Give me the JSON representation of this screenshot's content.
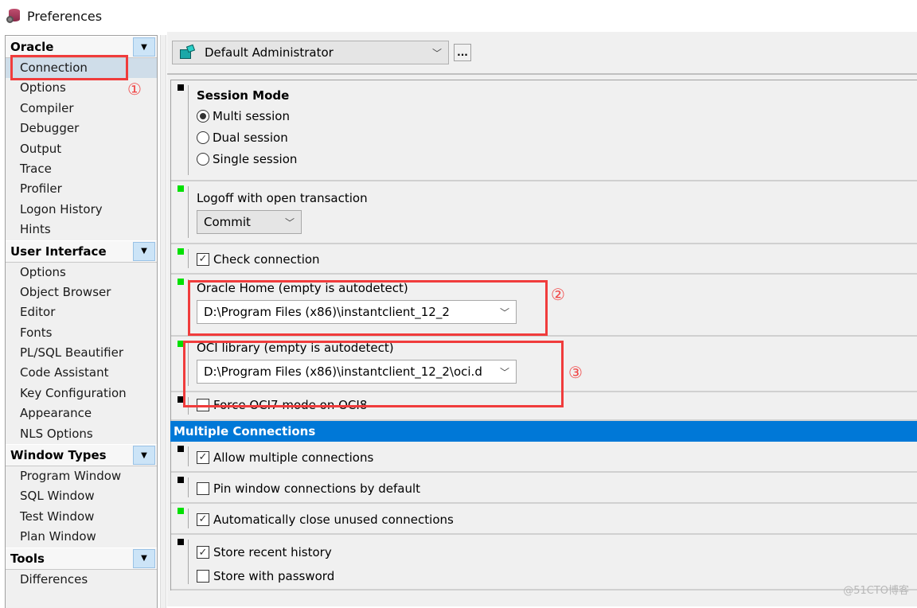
{
  "window": {
    "title": "Preferences",
    "icon": "database-gear-icon"
  },
  "sidebar": {
    "groups": [
      {
        "label": "Oracle",
        "toggle_icon": "dropdown-arrow-icon",
        "items": [
          "Connection",
          "Options",
          "Compiler",
          "Debugger",
          "Output",
          "Trace",
          "Profiler",
          "Logon History",
          "Hints"
        ],
        "selected": "Connection"
      },
      {
        "label": "User Interface",
        "toggle_icon": "dropdown-arrow-icon",
        "items": [
          "Options",
          "Object Browser",
          "Editor",
          "Fonts",
          "PL/SQL Beautifier",
          "Code Assistant",
          "Key Configuration",
          "Appearance",
          "NLS Options"
        ]
      },
      {
        "label": "Window Types",
        "toggle_icon": "dropdown-arrow-icon",
        "items": [
          "Program Window",
          "SQL Window",
          "Test Window",
          "Plan Window"
        ]
      },
      {
        "label": "Tools",
        "toggle_icon": "dropdown-arrow-icon",
        "items": [
          "Differences"
        ]
      }
    ]
  },
  "toolbar": {
    "profile": "Default Administrator",
    "profile_icon": "admin-blocks-icon",
    "more_button": "..."
  },
  "settings": {
    "session_mode": {
      "title": "Session Mode",
      "options": [
        "Multi session",
        "Dual session",
        "Single session"
      ],
      "selected": "Multi session",
      "marker": "black"
    },
    "logoff": {
      "label": "Logoff with open transaction",
      "value": "Commit",
      "marker": "green"
    },
    "check_connection": {
      "label": "Check connection",
      "checked": true,
      "marker": "green"
    },
    "oracle_home": {
      "label": "Oracle Home (empty is autodetect)",
      "value": "D:\\Program Files (x86)\\instantclient_12_2",
      "marker": "green"
    },
    "oci_library": {
      "label": "OCI library (empty is autodetect)",
      "value": "D:\\Program Files (x86)\\instantclient_12_2\\oci.d",
      "marker": "green"
    },
    "force_oci7": {
      "label": "Force OCI7 mode on OCI8",
      "checked": false,
      "marker": "black"
    }
  },
  "multiple_connections": {
    "title": "Multiple Connections",
    "allow_multiple": {
      "label": "Allow multiple connections",
      "checked": true,
      "marker": "black"
    },
    "pin_window": {
      "label": "Pin window connections by default",
      "checked": false,
      "marker": "black"
    },
    "auto_close": {
      "label": "Automatically close unused connections",
      "checked": true,
      "marker": "green"
    },
    "store_history": {
      "label": "Store recent history",
      "checked": true,
      "marker": "black"
    },
    "store_password": {
      "label": "Store with password",
      "checked": false
    }
  },
  "annotations": [
    "①",
    "②",
    "③"
  ],
  "annotation_color": "#f03c3c",
  "accent_color": "#0078d7",
  "watermark": "@51CTO博客"
}
